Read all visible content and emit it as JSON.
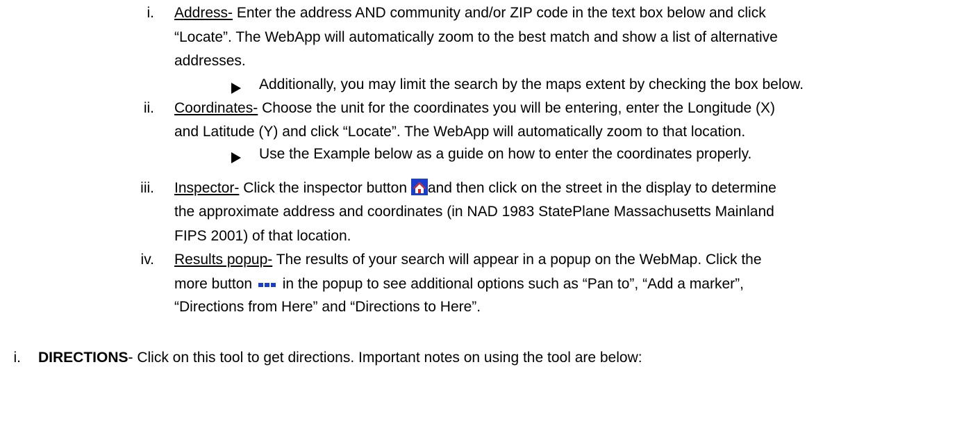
{
  "items": {
    "address": {
      "numeral": "i.",
      "term": "Address-",
      "line1": " Enter the address AND community and/or ZIP code in the text box below and click",
      "line2": "“Locate”.  The WebApp will automatically zoom to the best match and show a list of alternative",
      "line3": "addresses.",
      "bullet": "Additionally, you may limit the search by the maps extent by checking the box below."
    },
    "coordinates": {
      "numeral": "ii.",
      "term": "Coordinates-",
      "line1": " Choose the unit for the coordinates you will be entering, enter the Longitude (X)",
      "line2": "and Latitude (Y) and click “Locate”.  The WebApp will automatically zoom to that location.",
      "bullet": "Use the Example below as a guide on how to enter the coordinates properly."
    },
    "inspector": {
      "numeral": "iii.",
      "term": "Inspector-",
      "line1a": " Click the inspector button ",
      "line1b": "and then click on the street in the display to determine",
      "line2": "the approximate address and coordinates (in NAD 1983 StatePlane Massachusetts Mainland",
      "line3": "FIPS 2001) of that location.",
      "icon": "inspector-house-icon"
    },
    "results": {
      "numeral": "iv.",
      "term": "Results popup-",
      "line1": " The results of your search will appear in a popup on the WebMap.  Click the",
      "line2a": "more button ",
      "line2b": " in the popup to see additional options such as “Pan to”, “Add a marker”,",
      "line3": "“Directions from Here” and “Directions to Here”.",
      "icon": "more-dots-icon"
    }
  },
  "directions": {
    "numeral": "i.",
    "term": "DIRECTIONS",
    "text": "- Click on this tool to get directions.  Important notes on using the tool are below:"
  },
  "colors": {
    "text": "#000000",
    "icon_blue": "#1a3fd0",
    "icon_red": "#d42020"
  }
}
